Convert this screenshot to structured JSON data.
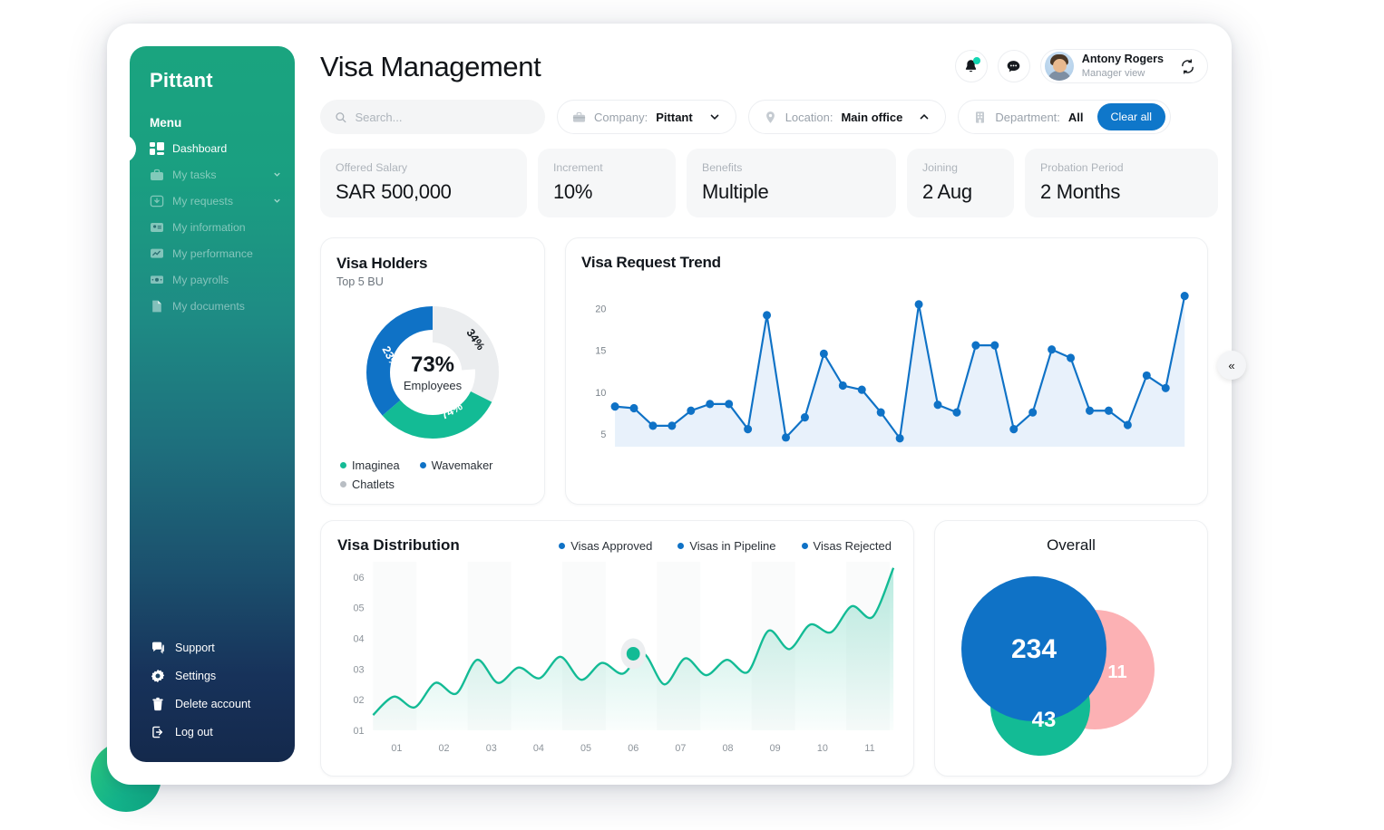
{
  "sidebar": {
    "brand": "Pittant",
    "menu_label": "Menu",
    "items": [
      {
        "label": "Dashboard",
        "icon": "dashboard-icon",
        "active": true,
        "chevron": false
      },
      {
        "label": "My tasks",
        "icon": "briefcase-icon",
        "active": false,
        "chevron": true
      },
      {
        "label": "My requests",
        "icon": "inbox-icon",
        "active": false,
        "chevron": true
      },
      {
        "label": "My information",
        "icon": "id-card-icon",
        "active": false,
        "chevron": false
      },
      {
        "label": "My performance",
        "icon": "chart-icon",
        "active": false,
        "chevron": false
      },
      {
        "label": "My payrolls",
        "icon": "money-icon",
        "active": false,
        "chevron": false
      },
      {
        "label": "My documents",
        "icon": "document-icon",
        "active": false,
        "chevron": false
      }
    ],
    "bottom_items": [
      {
        "label": "Support",
        "icon": "chat-icon"
      },
      {
        "label": "Settings",
        "icon": "gear-icon"
      },
      {
        "label": "Delete account",
        "icon": "trash-icon"
      },
      {
        "label": "Log out",
        "icon": "logout-icon"
      }
    ],
    "collapse_glyph": "«"
  },
  "header": {
    "title": "Visa Management",
    "user": {
      "name": "Antony Rogers",
      "role": "Manager view"
    }
  },
  "filters": {
    "search_placeholder": "Search...",
    "search_value": "",
    "company": {
      "label": "Company:",
      "value": "Pittant"
    },
    "location": {
      "label": "Location:",
      "value": "Main office"
    },
    "department": {
      "label": "Department:",
      "value": "All"
    },
    "clear_all": "Clear all"
  },
  "stats": [
    {
      "label": "Offered Salary",
      "value": "SAR 500,000"
    },
    {
      "label": "Increment",
      "value": "10%"
    },
    {
      "label": "Benefits",
      "value": "Multiple"
    },
    {
      "label": "Joining",
      "value": "2 Aug"
    },
    {
      "label": "Probation Period",
      "value": "2 Months"
    }
  ],
  "visa_holders": {
    "title": "Visa Holders",
    "subtitle": "Top 5 BU",
    "center_value": "73%",
    "center_label": "Employees",
    "legend": [
      {
        "label": "Imaginea",
        "color": "#15bb96"
      },
      {
        "label": "Wavemaker",
        "color": "#0f72c6"
      },
      {
        "label": "Chatlets",
        "color": "#b9bec4"
      }
    ]
  },
  "visa_trend": {
    "title": "Visa Request Trend"
  },
  "visa_distribution": {
    "title": "Visa Distribution",
    "legend": [
      {
        "label": "Visas Approved",
        "color": "#0f72c6"
      },
      {
        "label": "Visas in Pipeline",
        "color": "#0f72c6"
      },
      {
        "label": "Visas Rejected",
        "color": "#0f72c6"
      }
    ]
  },
  "overall": {
    "title": "Overall",
    "circles": [
      {
        "value": "234",
        "color": "#0f72c6"
      },
      {
        "value": "11",
        "color": "#fcb1b4"
      },
      {
        "value": "43",
        "color": "#13bb95"
      }
    ]
  },
  "chart_data": [
    {
      "type": "pie",
      "name": "visa-holders-donut",
      "title": "Visa Holders",
      "subtitle": "Top 5 BU",
      "center_text": "73% Employees",
      "labels": [
        "Chatlets",
        "Imaginea",
        "Wavemaker"
      ],
      "slice_labels": [
        "34%",
        "74%",
        "23%"
      ],
      "values": [
        34,
        74,
        23
      ],
      "colors": [
        "#ebedef",
        "#13bb95",
        "#0f72c6"
      ],
      "legend_position": "bottom"
    },
    {
      "type": "line",
      "name": "visa-request-trend",
      "title": "Visa Request Trend",
      "xlabel": "",
      "ylabel": "",
      "ylim": [
        3.5,
        22
      ],
      "yticks": [
        5,
        10,
        15,
        20
      ],
      "grid": false,
      "area_fill": true,
      "color": "#0f72c6",
      "x": [
        1,
        2,
        3,
        4,
        5,
        6,
        7,
        8,
        9,
        10,
        11,
        12,
        13,
        14,
        15,
        16,
        17,
        18,
        19,
        20,
        21,
        22,
        23,
        24,
        25,
        26,
        27,
        28,
        29,
        30,
        31
      ],
      "values": [
        8.3,
        8.1,
        6.0,
        6.0,
        7.8,
        8.6,
        8.6,
        5.6,
        19.2,
        4.6,
        7.0,
        14.6,
        10.8,
        10.3,
        7.6,
        4.5,
        20.5,
        8.5,
        7.6,
        15.6,
        15.6,
        5.6,
        7.6,
        15.1,
        14.1,
        7.8,
        7.8,
        6.1,
        12.0,
        10.5,
        21.5
      ]
    },
    {
      "type": "area",
      "name": "visa-distribution",
      "title": "Visa Distribution",
      "categories": [
        "01",
        "02",
        "03",
        "04",
        "05",
        "06",
        "07",
        "08",
        "09",
        "10",
        "11"
      ],
      "yticks": [
        "01",
        "02",
        "03",
        "04",
        "05",
        "06"
      ],
      "ylim": [
        1,
        6.5
      ],
      "grid": false,
      "color": "#13bb95",
      "legend": [
        "Visas Approved",
        "Visas in Pipeline",
        "Visas Rejected"
      ],
      "legend_position": "top-right",
      "highlight_point": {
        "x": "06",
        "y": 3.5
      },
      "values": [
        1.5,
        2.1,
        1.75,
        2.55,
        2.2,
        3.3,
        2.55,
        3.05,
        2.7,
        3.4,
        2.65,
        3.2,
        2.85,
        3.5,
        2.5,
        3.35,
        2.8,
        3.3,
        2.9,
        4.25,
        3.65,
        4.45,
        4.2,
        5.05,
        4.7,
        6.3
      ]
    },
    {
      "type": "pie",
      "name": "overall-venn",
      "title": "Overall",
      "labels": [
        "Approved",
        "Rejected",
        "Pipeline"
      ],
      "values": [
        234,
        11,
        43
      ],
      "colors": [
        "#0f72c6",
        "#fcb1b4",
        "#13bb95"
      ]
    }
  ]
}
